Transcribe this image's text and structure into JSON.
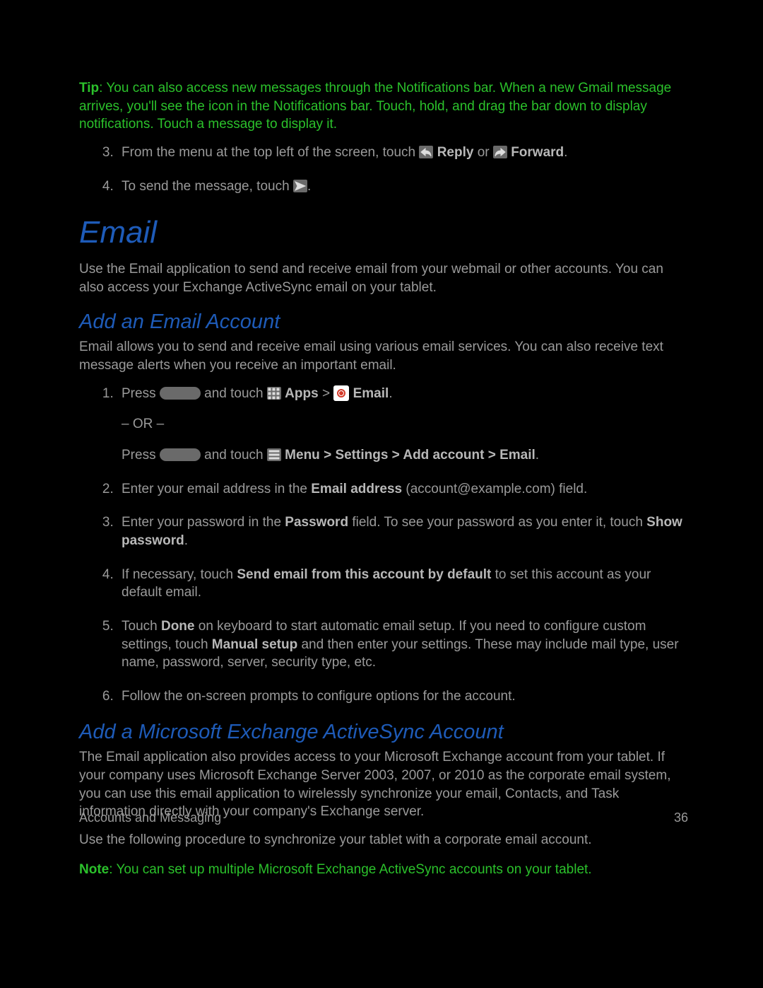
{
  "tip": {
    "label": "Tip",
    "text": ": You can also access new messages through the Notifications bar. When a new Gmail message arrives, you'll see the icon in the Notifications bar. Touch, hold, and drag the bar down to display notifications. Touch a message to display it."
  },
  "topSteps": {
    "step3a": "From the menu at the top left of the screen, touch ",
    "reply": " Reply",
    "or": " or ",
    "forward": " Forward",
    "period": ".",
    "step4": "To send the message, touch "
  },
  "h1": "Email",
  "emailIntro": "Use the Email application to send and receive email from your webmail or other accounts. You can also access your Exchange ActiveSync email on your tablet.",
  "h2a": "Add an Email Account",
  "addIntro": "Email allows you to send and receive email using various email services. You can also receive text message alerts when you receive an important email.",
  "steps": {
    "s1": {
      "press": "Press ",
      "andTouch": " and touch ",
      "apps": " Apps",
      "gt": " > ",
      "email": " Email",
      "dot": ".",
      "or": "– OR –",
      "press2": "Press ",
      "andTouch2": " and touch ",
      "menu": " Menu",
      "settings": "Settings",
      "addAcct": "Add account",
      "emailB": "Email"
    },
    "s2a": "Enter your email address in the ",
    "s2b": "Email address",
    "s2c": " (account@example.com) field.",
    "s3a": "Enter your password in the ",
    "s3b": "Password",
    "s3c": " field. To see your password as you enter it, touch ",
    "s3d": "Show password",
    "s3e": ".",
    "s4a": "If necessary, touch ",
    "s4b": "Send email from this account by default",
    "s4c": " to set this account as your default email.",
    "s5a": "Touch ",
    "s5b": "Done",
    "s5c": " on keyboard to start automatic email setup. If you need to configure custom settings, touch ",
    "s5d": "Manual setup",
    "s5e": " and then enter your settings. These may include mail type, user name, password, server, security type, etc.",
    "s6": "Follow the on-screen prompts to configure options for the account."
  },
  "h2b": "Add a Microsoft Exchange ActiveSync Account",
  "exIntro": "The Email application also provides access to your Microsoft Exchange account from your tablet. If your company uses Microsoft Exchange Server 2003, 2007, or 2010 as the corporate email system, you can use this email application to wirelessly synchronize your email, Contacts, and Task information directly with your company's Exchange server.",
  "exUse": "Use the following procedure to synchronize your tablet with a corporate email account.",
  "note": {
    "label": "Note",
    "text": ": You can set up multiple Microsoft Exchange ActiveSync accounts on your tablet."
  },
  "footer": {
    "left": "Accounts and Messaging",
    "right": "36"
  }
}
